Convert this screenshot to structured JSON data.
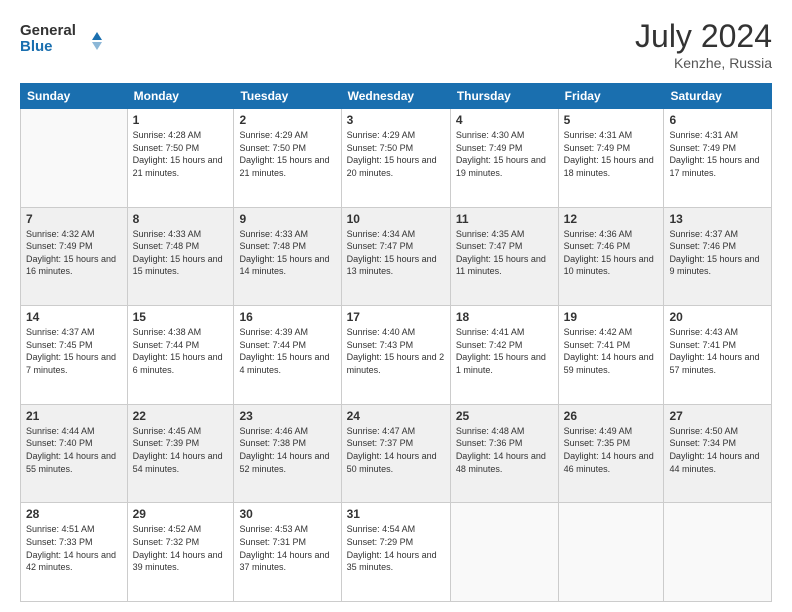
{
  "header": {
    "logo_line1": "General",
    "logo_line2": "Blue",
    "month_year": "July 2024",
    "location": "Kenzhe, Russia"
  },
  "weekdays": [
    "Sunday",
    "Monday",
    "Tuesday",
    "Wednesday",
    "Thursday",
    "Friday",
    "Saturday"
  ],
  "weeks": [
    [
      {
        "day": "",
        "empty": true
      },
      {
        "day": "1",
        "sunrise": "4:28 AM",
        "sunset": "7:50 PM",
        "daylight": "15 hours and 21 minutes."
      },
      {
        "day": "2",
        "sunrise": "4:29 AM",
        "sunset": "7:50 PM",
        "daylight": "15 hours and 21 minutes."
      },
      {
        "day": "3",
        "sunrise": "4:29 AM",
        "sunset": "7:50 PM",
        "daylight": "15 hours and 20 minutes."
      },
      {
        "day": "4",
        "sunrise": "4:30 AM",
        "sunset": "7:49 PM",
        "daylight": "15 hours and 19 minutes."
      },
      {
        "day": "5",
        "sunrise": "4:31 AM",
        "sunset": "7:49 PM",
        "daylight": "15 hours and 18 minutes."
      },
      {
        "day": "6",
        "sunrise": "4:31 AM",
        "sunset": "7:49 PM",
        "daylight": "15 hours and 17 minutes."
      }
    ],
    [
      {
        "day": "7",
        "sunrise": "4:32 AM",
        "sunset": "7:49 PM",
        "daylight": "15 hours and 16 minutes."
      },
      {
        "day": "8",
        "sunrise": "4:33 AM",
        "sunset": "7:48 PM",
        "daylight": "15 hours and 15 minutes."
      },
      {
        "day": "9",
        "sunrise": "4:33 AM",
        "sunset": "7:48 PM",
        "daylight": "15 hours and 14 minutes."
      },
      {
        "day": "10",
        "sunrise": "4:34 AM",
        "sunset": "7:47 PM",
        "daylight": "15 hours and 13 minutes."
      },
      {
        "day": "11",
        "sunrise": "4:35 AM",
        "sunset": "7:47 PM",
        "daylight": "15 hours and 11 minutes."
      },
      {
        "day": "12",
        "sunrise": "4:36 AM",
        "sunset": "7:46 PM",
        "daylight": "15 hours and 10 minutes."
      },
      {
        "day": "13",
        "sunrise": "4:37 AM",
        "sunset": "7:46 PM",
        "daylight": "15 hours and 9 minutes."
      }
    ],
    [
      {
        "day": "14",
        "sunrise": "4:37 AM",
        "sunset": "7:45 PM",
        "daylight": "15 hours and 7 minutes."
      },
      {
        "day": "15",
        "sunrise": "4:38 AM",
        "sunset": "7:44 PM",
        "daylight": "15 hours and 6 minutes."
      },
      {
        "day": "16",
        "sunrise": "4:39 AM",
        "sunset": "7:44 PM",
        "daylight": "15 hours and 4 minutes."
      },
      {
        "day": "17",
        "sunrise": "4:40 AM",
        "sunset": "7:43 PM",
        "daylight": "15 hours and 2 minutes."
      },
      {
        "day": "18",
        "sunrise": "4:41 AM",
        "sunset": "7:42 PM",
        "daylight": "15 hours and 1 minute."
      },
      {
        "day": "19",
        "sunrise": "4:42 AM",
        "sunset": "7:41 PM",
        "daylight": "14 hours and 59 minutes."
      },
      {
        "day": "20",
        "sunrise": "4:43 AM",
        "sunset": "7:41 PM",
        "daylight": "14 hours and 57 minutes."
      }
    ],
    [
      {
        "day": "21",
        "sunrise": "4:44 AM",
        "sunset": "7:40 PM",
        "daylight": "14 hours and 55 minutes."
      },
      {
        "day": "22",
        "sunrise": "4:45 AM",
        "sunset": "7:39 PM",
        "daylight": "14 hours and 54 minutes."
      },
      {
        "day": "23",
        "sunrise": "4:46 AM",
        "sunset": "7:38 PM",
        "daylight": "14 hours and 52 minutes."
      },
      {
        "day": "24",
        "sunrise": "4:47 AM",
        "sunset": "7:37 PM",
        "daylight": "14 hours and 50 minutes."
      },
      {
        "day": "25",
        "sunrise": "4:48 AM",
        "sunset": "7:36 PM",
        "daylight": "14 hours and 48 minutes."
      },
      {
        "day": "26",
        "sunrise": "4:49 AM",
        "sunset": "7:35 PM",
        "daylight": "14 hours and 46 minutes."
      },
      {
        "day": "27",
        "sunrise": "4:50 AM",
        "sunset": "7:34 PM",
        "daylight": "14 hours and 44 minutes."
      }
    ],
    [
      {
        "day": "28",
        "sunrise": "4:51 AM",
        "sunset": "7:33 PM",
        "daylight": "14 hours and 42 minutes."
      },
      {
        "day": "29",
        "sunrise": "4:52 AM",
        "sunset": "7:32 PM",
        "daylight": "14 hours and 39 minutes."
      },
      {
        "day": "30",
        "sunrise": "4:53 AM",
        "sunset": "7:31 PM",
        "daylight": "14 hours and 37 minutes."
      },
      {
        "day": "31",
        "sunrise": "4:54 AM",
        "sunset": "7:29 PM",
        "daylight": "14 hours and 35 minutes."
      },
      {
        "day": "",
        "empty": true
      },
      {
        "day": "",
        "empty": true
      },
      {
        "day": "",
        "empty": true
      }
    ]
  ]
}
